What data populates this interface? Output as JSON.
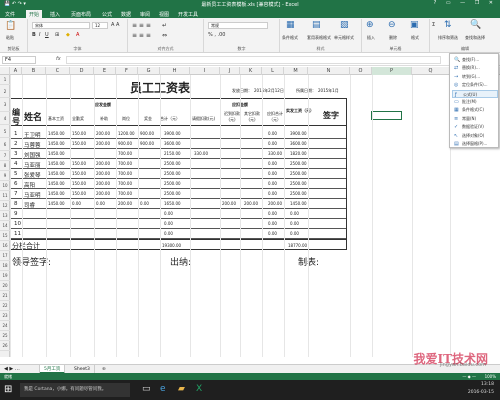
{
  "app": {
    "title": "最新员工工资表模板.xls [兼容模式] - Excel",
    "window_controls": "? ▭ — ❐ ✕"
  },
  "ribbon_tabs": [
    "文件",
    "开始",
    "插入",
    "页面布局",
    "公式",
    "数据",
    "审阅",
    "视图",
    "开发工具"
  ],
  "ribbon": {
    "clipboard": "剪贴板",
    "font_group": "字体",
    "alignment": "对齐方式",
    "number": "数字",
    "styles": "样式",
    "cells": "单元格",
    "editing": "编辑",
    "font_name": "宋体",
    "font_size": "12",
    "number_format": "常规",
    "cond_format": "条件格式",
    "table_format": "套用表格格式",
    "cell_styles": "单元格样式",
    "insert": "插入",
    "delete": "删除",
    "format": "格式",
    "sort_filter": "排序和筛选",
    "find_select": "查找和选择",
    "paste": "粘贴"
  },
  "namebox": "F4",
  "columns": [
    "A",
    "B",
    "C",
    "D",
    "E",
    "F",
    "G",
    "H",
    "I",
    "J",
    "K",
    "L",
    "M",
    "N",
    "O",
    "P",
    "Q"
  ],
  "rows": [
    "1",
    "2",
    "3",
    "4",
    "5",
    "6",
    "7",
    "8",
    "9",
    "10",
    "11",
    "12",
    "13",
    "14",
    "15",
    "16",
    "17",
    "18",
    "19",
    "20",
    "21",
    "22",
    "23",
    "24",
    "25",
    "26",
    "27"
  ],
  "sheet": {
    "title": "员工工资表",
    "issue_date_label": "发放日期：",
    "issue_date": "2015年2月12日",
    "belong_label": "所属日期：",
    "belong_date": "2015年1月",
    "h_no": "编号",
    "h_name": "姓名",
    "h_payable": "应发金额",
    "h_deduct": "应扣金额",
    "h_actual": "实发工资（元）",
    "h_sign": "签字",
    "h_base": "基本工资",
    "h_overtime": "全勤奖",
    "h_subsidy": "补助",
    "h_post": "岗位",
    "h_bonus": "奖金",
    "h_total": "合计（元）",
    "h_ded1": "请假扣款(元)",
    "h_ded2": "迟到扣款(元)",
    "h_ded3": "其它扣款(元)",
    "h_ded_total": "应扣合计（元）",
    "employees": [
      {
        "no": "1",
        "name": "王卫明",
        "base": "1450.00",
        "full": "150.00",
        "sub": "200.00",
        "post": "1200.00",
        "bonus": "900.00",
        "total": "3900.00",
        "d1": "",
        "d2": "",
        "d3": "",
        "dt": "0.00",
        "actual": "3900.00"
      },
      {
        "no": "2",
        "name": "马蓉蓉",
        "base": "1450.00",
        "full": "150.00",
        "sub": "200.00",
        "post": "900.00",
        "bonus": "900.00",
        "total": "3600.00",
        "d1": "",
        "d2": "",
        "d3": "",
        "dt": "0.00",
        "actual": "3600.00"
      },
      {
        "no": "3",
        "name": "刘国强",
        "base": "1450.00",
        "full": "",
        "sub": "",
        "post": "700.00",
        "bonus": "",
        "total": "2150.00",
        "d1": "330.00",
        "d2": "",
        "d3": "",
        "dt": "330.00",
        "actual": "1820.00"
      },
      {
        "no": "4",
        "name": "马亚丽",
        "base": "1450.00",
        "full": "150.00",
        "sub": "200.00",
        "post": "700.00",
        "bonus": "",
        "total": "2500.00",
        "d1": "",
        "d2": "",
        "d3": "",
        "dt": "0.00",
        "actual": "2500.00"
      },
      {
        "no": "5",
        "name": "张爱琴",
        "base": "1450.00",
        "full": "150.00",
        "sub": "200.00",
        "post": "700.00",
        "bonus": "",
        "total": "2500.00",
        "d1": "",
        "d2": "",
        "d3": "",
        "dt": "0.00",
        "actual": "2500.00"
      },
      {
        "no": "6",
        "name": "高阳",
        "base": "1450.00",
        "full": "150.00",
        "sub": "200.00",
        "post": "700.00",
        "bonus": "",
        "total": "2500.00",
        "d1": "",
        "d2": "",
        "d3": "",
        "dt": "0.00",
        "actual": "2500.00"
      },
      {
        "no": "7",
        "name": "马亚明",
        "base": "1450.00",
        "full": "150.00",
        "sub": "200.00",
        "post": "700.00",
        "bonus": "",
        "total": "2500.00",
        "d1": "",
        "d2": "",
        "d3": "",
        "dt": "0.00",
        "actual": "2500.00"
      },
      {
        "no": "8",
        "name": "司睿",
        "base": "1450.00",
        "full": "0.00",
        "sub": "0.00",
        "post": "200.00",
        "bonus": "0.00",
        "total": "1650.00",
        "d1": "",
        "d2": "200.00",
        "d3": "200.00",
        "dt": "200.00",
        "actual": "1450.00"
      },
      {
        "no": "9",
        "name": "",
        "base": "",
        "full": "",
        "sub": "",
        "post": "",
        "bonus": "",
        "total": "0.00",
        "d1": "",
        "d2": "",
        "d3": "",
        "dt": "0.00",
        "actual": "0.00"
      },
      {
        "no": "10",
        "name": "",
        "base": "",
        "full": "",
        "sub": "",
        "post": "",
        "bonus": "",
        "total": "0.00",
        "d1": "",
        "d2": "",
        "d3": "",
        "dt": "0.00",
        "actual": "0.00"
      },
      {
        "no": "11",
        "name": "",
        "base": "",
        "full": "",
        "sub": "",
        "post": "",
        "bonus": "",
        "total": "0.00",
        "d1": "",
        "d2": "",
        "d3": "",
        "dt": "0.00",
        "actual": "0.00"
      }
    ],
    "subtotal_label": "分栏合计",
    "subtotal_total": "19300.00",
    "subtotal_actual": "18770.00",
    "sign_leader": "领导签字:",
    "sign_cashier": "出纳:",
    "sign_maker": "制表:"
  },
  "menu": {
    "items": [
      "查找(F)...",
      "替换(R)...",
      "转到(G)...",
      "定位条件(S)...",
      "公式(U)",
      "批注(M)",
      "条件格式(C)",
      "常量(N)",
      "数据验证(V)",
      "选择对象(O)",
      "选择窗格(P)..."
    ],
    "highlighted_index": 4
  },
  "sheet_tabs": [
    "5月工资",
    "Sheet3"
  ],
  "status": {
    "ready": "就绪",
    "zoom": "100%"
  },
  "taskbar": {
    "search": "我是 Cortana，小娜。有问题尽管问我。",
    "time": "13:18",
    "date": "2016-03-15"
  },
  "watermark": {
    "main": "我爱IT技术网",
    "sub": "jingyan.baidu.com"
  },
  "colors": {
    "excel_green": "#217346",
    "ribbon_bg": "#f3f3f3",
    "highlight": "#e8f2fa"
  }
}
